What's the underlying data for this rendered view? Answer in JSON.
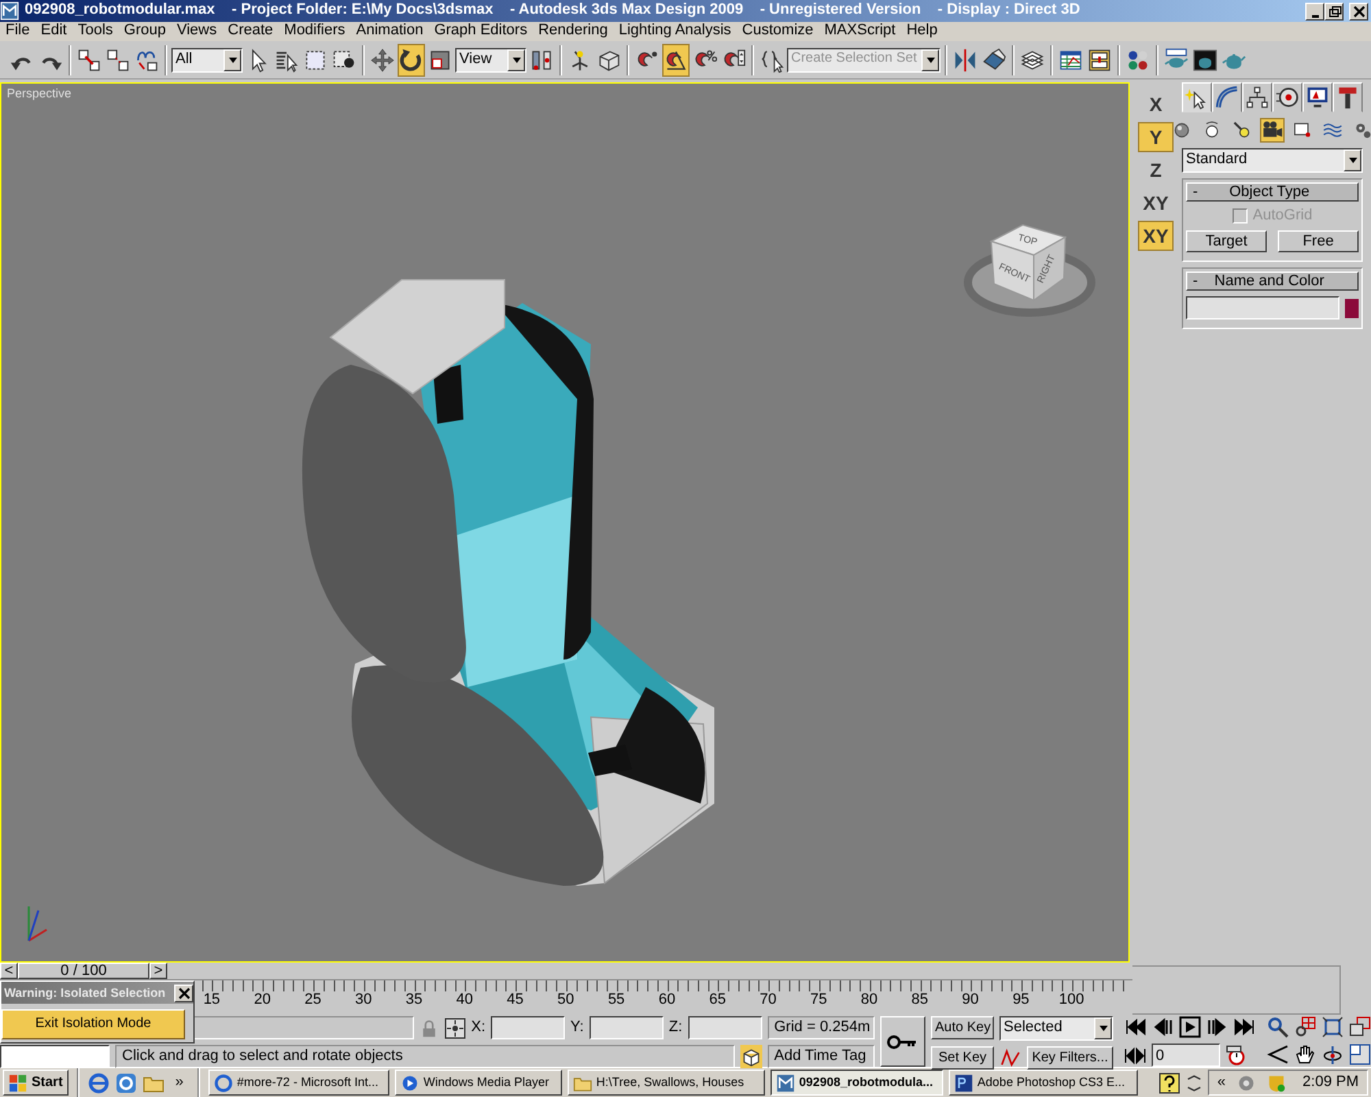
{
  "window": {
    "title": "092908_robotmodular.max    - Project Folder: E:\\My Docs\\3dsmax    - Autodesk 3ds Max Design 2009    - Unregistered Version    - Display : Direct 3D"
  },
  "menu": [
    "File",
    "Edit",
    "Tools",
    "Group",
    "Views",
    "Create",
    "Modifiers",
    "Animation",
    "Graph Editors",
    "Rendering",
    "Lighting Analysis",
    "Customize",
    "MAXScript",
    "Help"
  ],
  "toolbar": [
    {
      "kind": "icon",
      "selected": false
    },
    {
      "kind": "icon",
      "selected": false
    },
    {
      "kind": "separator"
    },
    {
      "kind": "icon",
      "selected": false
    },
    {
      "kind": "icon",
      "selected": false
    },
    {
      "kind": "icon",
      "selected": false
    },
    {
      "kind": "separator"
    },
    {
      "kind": "dropdown",
      "value": "All",
      "disabled": false
    },
    {
      "kind": "icon",
      "selected": false
    },
    {
      "kind": "icon",
      "selected": false
    },
    {
      "kind": "icon",
      "selected": false
    },
    {
      "kind": "icon",
      "selected": false
    },
    {
      "kind": "separator"
    },
    {
      "kind": "icon",
      "selected": false
    },
    {
      "kind": "icon",
      "selected": true
    },
    {
      "kind": "icon",
      "selected": false
    },
    {
      "kind": "dropdown",
      "value": "View",
      "disabled": false
    },
    {
      "kind": "icon",
      "selected": false
    },
    {
      "kind": "separator"
    },
    {
      "kind": "icon",
      "selected": false
    },
    {
      "kind": "icon",
      "selected": false
    },
    {
      "kind": "separator"
    },
    {
      "kind": "icon",
      "selected": false
    },
    {
      "kind": "icon",
      "selected": true
    },
    {
      "kind": "icon",
      "selected": false
    },
    {
      "kind": "icon",
      "selected": false
    },
    {
      "kind": "separator"
    },
    {
      "kind": "icon",
      "selected": false
    },
    {
      "kind": "dropdown",
      "value": "Create Selection Set",
      "disabled": true
    },
    {
      "kind": "separator"
    },
    {
      "kind": "icon",
      "selected": false
    },
    {
      "kind": "icon",
      "selected": false
    },
    {
      "kind": "separator"
    },
    {
      "kind": "icon",
      "selected": false
    },
    {
      "kind": "separator"
    },
    {
      "kind": "icon",
      "selected": false
    },
    {
      "kind": "icon",
      "selected": false
    },
    {
      "kind": "separator"
    },
    {
      "kind": "icon",
      "selected": false
    },
    {
      "kind": "separator"
    },
    {
      "kind": "icon",
      "selected": false
    },
    {
      "kind": "icon",
      "selected": false
    },
    {
      "kind": "icon",
      "selected": false
    }
  ],
  "viewport": {
    "label": "Perspective",
    "active": true,
    "viewcube": [
      "TOP",
      "FRONT",
      "RIGHT"
    ]
  },
  "axis_constraints": [
    {
      "label": "X",
      "selected": false
    },
    {
      "label": "Y",
      "selected": true
    },
    {
      "label": "Z",
      "selected": false
    },
    {
      "label": "XY",
      "selected": false
    },
    {
      "label": "XY",
      "selected": true
    }
  ],
  "command_panel": {
    "tabs": [
      {
        "selected": true
      },
      {
        "selected": false
      },
      {
        "selected": false
      },
      {
        "selected": false
      },
      {
        "selected": false
      },
      {
        "selected": false
      }
    ],
    "categories": [
      {
        "selected": false
      },
      {
        "selected": false
      },
      {
        "selected": false
      },
      {
        "selected": true
      },
      {
        "selected": false
      },
      {
        "selected": false
      },
      {
        "selected": false
      }
    ],
    "dropdown": "Standard",
    "rollouts": [
      {
        "toggle": "-",
        "title": "Object Type",
        "autogrid": {
          "label": "AutoGrid",
          "checked": false,
          "disabled": true
        },
        "buttons": [
          "Target",
          "Free"
        ]
      },
      {
        "toggle": "-",
        "title": "Name and Color",
        "color": "#8b0a3a"
      }
    ]
  },
  "time_slider": {
    "prev": "<",
    "position": "0 / 100",
    "next": ">",
    "level": 0
  },
  "ruler": [
    "15",
    "20",
    "25",
    "30",
    "35",
    "40",
    "45",
    "50",
    "55",
    "60",
    "65",
    "70",
    "75",
    "80",
    "85",
    "90",
    "95",
    "100"
  ],
  "warning_dialog": {
    "title": "Warning: Isolated Selection",
    "button": "Exit Isolation Mode"
  },
  "status": {
    "x_label": "X:",
    "y_label": "Y:",
    "z_label": "Z:",
    "grid": "Grid = 0.254m",
    "prompt": "Click and drag to select and rotate objects",
    "add_time_tag": "Add Time Tag",
    "auto_key": "Auto Key",
    "set_key": "Set Key",
    "key_mode": "Selected",
    "key_filters": "Key Filters...",
    "frame": "0"
  },
  "taskbar": {
    "start": "Start",
    "more": "»",
    "tasks": [
      {
        "label": "#more-72 - Microsoft Int...",
        "selected": false
      },
      {
        "label": "Windows Media Player",
        "selected": false
      },
      {
        "label": "H:\\Tree, Swallows, Houses",
        "selected": false
      },
      {
        "label": "092908_robotmodula...",
        "selected": true
      },
      {
        "label": "Adobe Photoshop CS3 E...",
        "selected": false
      }
    ],
    "tray_expand": "«",
    "clock": "2:09 PM"
  }
}
